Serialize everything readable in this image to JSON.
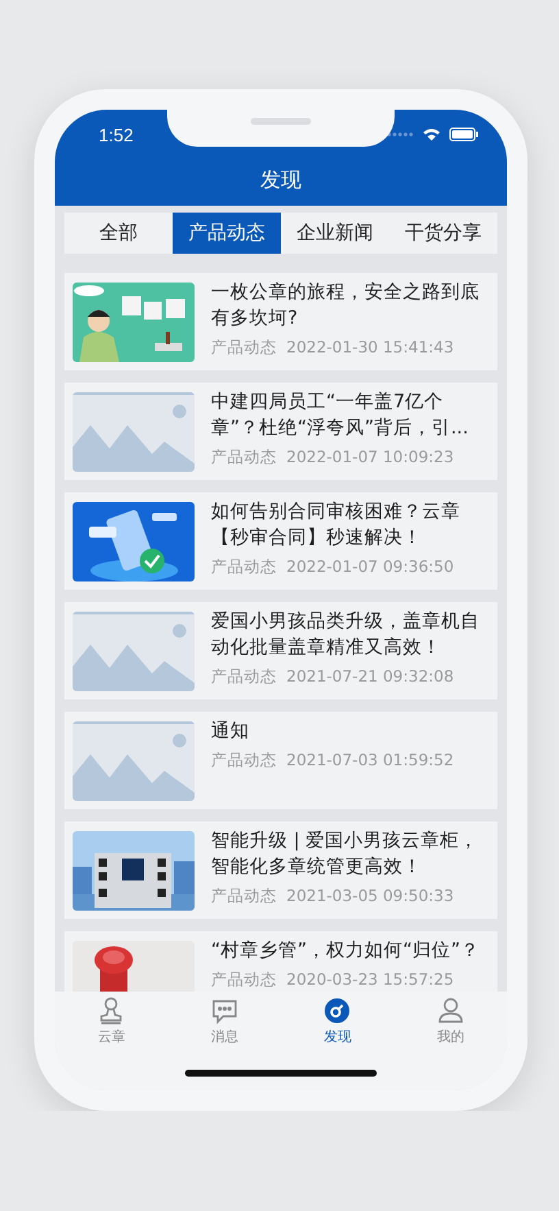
{
  "status_bar": {
    "time": "1:52"
  },
  "header": {
    "title": "发现"
  },
  "tabs": [
    {
      "label": "全部",
      "selected": false
    },
    {
      "label": "产品动态",
      "selected": true
    },
    {
      "label": "企业新闻",
      "selected": false
    },
    {
      "label": "干货分享",
      "selected": false
    }
  ],
  "articles": [
    {
      "title": "一枚公章的旅程，安全之路到底有多坎坷?",
      "category": "产品动态",
      "time": "2022-01-30 15:41:43"
    },
    {
      "title": "中建四局员工“一年盖7亿个章”？杜绝“浮夸风”背后，引...",
      "category": "产品动态",
      "time": "2022-01-07 10:09:23",
      "thumbnail": {
        "kind": "placeholder"
      }
    },
    {
      "title": "如何告别合同审核困难？云章【秒审合同】秒速解决！",
      "category": "产品动态",
      "time": "2022-01-07 09:36:50"
    },
    {
      "title": "爱国小男孩品类升级，盖章机自动化批量盖章精准又高效！",
      "category": "产品动态",
      "time": "2021-07-21 09:32:08",
      "thumbnail": {
        "kind": "placeholder"
      }
    },
    {
      "title": "通知",
      "category": "产品动态",
      "time": "2021-07-03 01:59:52",
      "thumbnail": {
        "kind": "placeholder"
      }
    },
    {
      "title": "智能升级 | 爱国小男孩云章柜，智能化多章统管更高效！",
      "category": "产品动态",
      "time": "2021-03-05 09:50:33"
    },
    {
      "title": "“村章乡管”，权力如何“归位”？",
      "category": "产品动态",
      "time": "2020-03-23 15:57:25"
    }
  ],
  "nav": [
    {
      "label": "云章",
      "kind": "stamp",
      "selected": false
    },
    {
      "label": "消息",
      "kind": "chat",
      "selected": false
    },
    {
      "label": "发现",
      "kind": "compass",
      "selected": true
    },
    {
      "label": "我的",
      "kind": "user",
      "selected": false
    }
  ]
}
